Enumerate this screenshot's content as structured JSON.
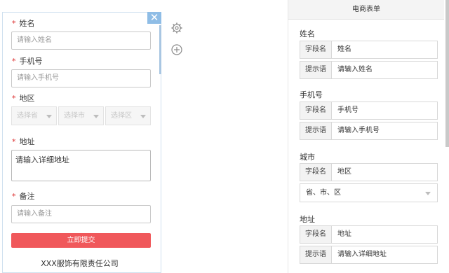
{
  "preview": {
    "close_icon": "close-icon",
    "fields": {
      "name_label": "姓名",
      "name_placeholder": "请输入姓名",
      "phone_label": "手机号",
      "phone_placeholder": "请输入手机号",
      "region_label": "地区",
      "province": "选择省",
      "city": "选择市",
      "district": "选择区",
      "address_label": "地址",
      "address_value": "请输入详细地址",
      "note_label": "备注",
      "note_placeholder": "请输入备注",
      "required_mark": "*"
    },
    "submit_label": "立即提交",
    "company": "XXX服饰有限责任公司"
  },
  "toolbar": {
    "settings_icon": "gear-icon",
    "add_icon": "plus-circle-icon"
  },
  "editor": {
    "title": "电商表单",
    "key_field": "字段名",
    "key_hint": "提示语",
    "groups": [
      {
        "title": "姓名",
        "field_value": "姓名",
        "hint_value": "请输入姓名"
      },
      {
        "title": "手机号",
        "field_value": "手机号",
        "hint_value": "请输入手机号"
      },
      {
        "title": "城市",
        "field_value": "地区",
        "select_value": "省、市、区"
      },
      {
        "title": "地址",
        "field_value": "地址",
        "hint_value": "请输入详细地址"
      }
    ]
  },
  "colors": {
    "submit": "#f0585b",
    "close": "#8fbde6",
    "required": "#dd3333"
  }
}
